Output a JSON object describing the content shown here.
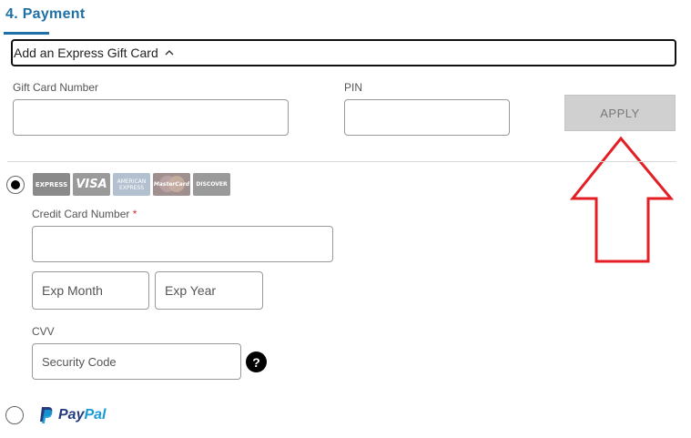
{
  "section": {
    "title": "4. Payment"
  },
  "express_gift_card": {
    "toggle_label": "Add an Express Gift Card",
    "gift_card_number_label": "Gift Card Number",
    "gift_card_number_value": "",
    "pin_label": "PIN",
    "pin_value": "",
    "apply_label": "APPLY"
  },
  "credit_card": {
    "selected": true,
    "logos": [
      {
        "name": "express-card-logo",
        "text": "EXPRESS",
        "color": "#8a8a8a"
      },
      {
        "name": "visa-logo",
        "text": "VISA",
        "color": "#9a9a9a"
      },
      {
        "name": "amex-logo",
        "text": "AMERICAN EXPRESS",
        "color": "#b3c0d0"
      },
      {
        "name": "mastercard-logo",
        "text": "MasterCard",
        "color": "#a08f8f"
      },
      {
        "name": "discover-logo",
        "text": "DISCOVER",
        "color": "#9a9a9a"
      }
    ],
    "number_label": "Credit Card Number",
    "required_mark": "*",
    "number_value": "",
    "exp_month_placeholder": "Exp Month",
    "exp_year_placeholder": "Exp Year",
    "cvv_label": "CVV",
    "cvv_placeholder": "Security Code",
    "help_symbol": "?"
  },
  "paypal": {
    "selected": false,
    "brand_part1": "Pay",
    "brand_part2": "Pal"
  },
  "colors": {
    "accent": "#1e6fa5",
    "arrow": "#e31e24",
    "apply_bg": "#d0d0d0"
  }
}
